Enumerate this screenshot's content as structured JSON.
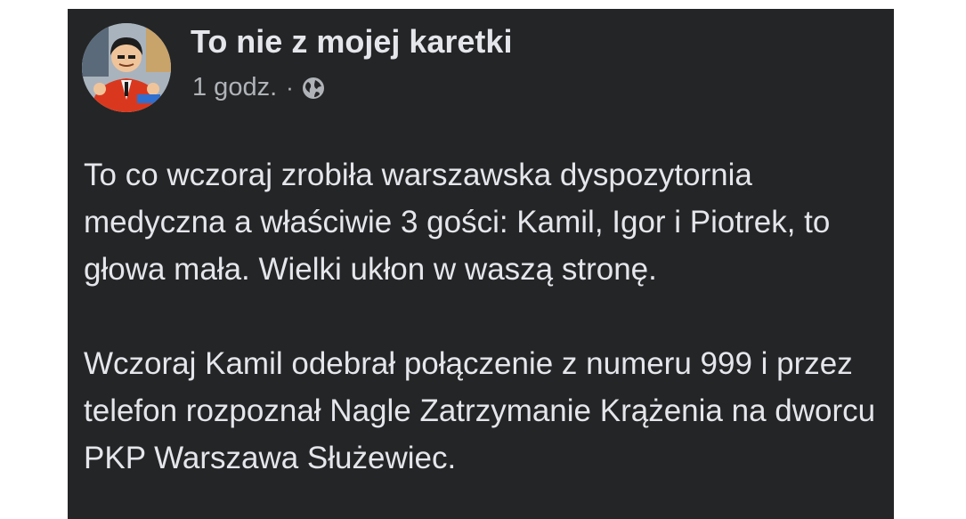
{
  "post": {
    "page_name": "To nie z mojej karetki",
    "time": "1 godz.",
    "separator": "·",
    "privacy_icon": "globe-icon",
    "paragraphs": [
      "To co wczoraj zrobiła warszawska dyspozytornia medyczna a właściwie 3 gości: Kamil, Igor i Piotrek, to głowa mała. Wielki ukłon w waszą stronę.",
      "Wczoraj Kamil odebrał połączenie z numeru 999 i przez telefon rozpoznał Nagle Zatrzymanie Krążenia na dworcu PKP Warszawa Służewiec."
    ]
  },
  "colors": {
    "card_background": "#242526",
    "primary_text": "#e4e6eb",
    "secondary_text": "#b0b3b8"
  }
}
